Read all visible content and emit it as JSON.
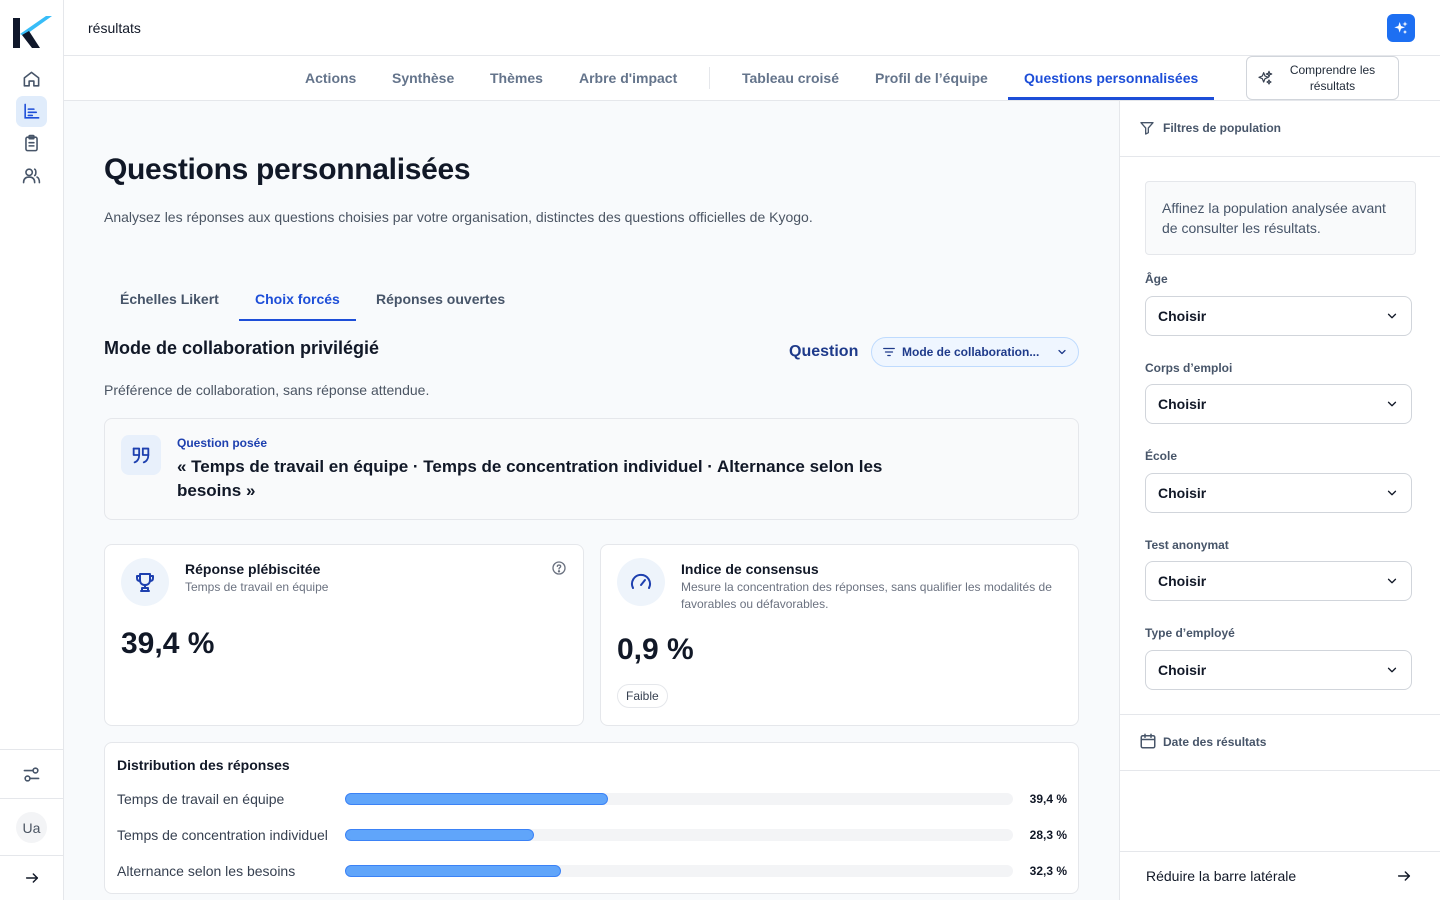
{
  "colors": {
    "accent": "#1d4ed8",
    "bar_fill": "#60a5fa",
    "ai_button": "#1d6ff2",
    "logo_dark": "#0f172a",
    "logo_light": "#38bdf8"
  },
  "rail": {
    "icons": [
      "home-icon",
      "chart-icon",
      "clipboard-icon",
      "users-icon"
    ],
    "bottom_icons": [
      "sliders-icon",
      "arrow-right-icon"
    ],
    "avatar_initials": "Ua"
  },
  "topbar": {
    "breadcrumb": "résultats",
    "ai_icon": "sparkles-icon"
  },
  "nav": {
    "tabs": [
      {
        "label": "Actions"
      },
      {
        "label": "Synthèse"
      },
      {
        "label": "Thèmes"
      },
      {
        "label": "Arbre d'impact"
      },
      {
        "label": "Tableau croisé"
      },
      {
        "label": "Profil de l’équipe"
      },
      {
        "label": "Questions personnalisées",
        "active": true
      }
    ],
    "understand_button": "Comprendre les résultats"
  },
  "main": {
    "title": "Questions personnalisées",
    "description": "Analysez les réponses aux questions choisies par votre organisation, distinctes des questions officielles de Kyogo.",
    "subtabs": [
      {
        "label": "Échelles Likert"
      },
      {
        "label": "Choix forcés",
        "active": true
      },
      {
        "label": "Réponses ouvertes"
      }
    ],
    "section_title": "Mode de collaboration privilégié",
    "question_label": "Question",
    "question_select": "Mode de collaboration...",
    "section_description": "Préférence de collaboration, sans réponse attendue.",
    "question_card": {
      "kicker": "Question posée",
      "text": "« Temps de travail en équipe · Temps de concentration individuel · Alternance selon les besoins »"
    },
    "kpi_top": {
      "title": "Réponse plébiscitée",
      "subtitle": "Temps de travail en équipe",
      "value": "39,4 %"
    },
    "kpi_consensus": {
      "title": "Indice de consensus",
      "subtitle": "Mesure la concentration des réponses, sans qualifier les modalités de favorables ou défavorables.",
      "value": "0,9 %",
      "badge": "Faible"
    },
    "distribution": {
      "title": "Distribution des réponses",
      "rows": [
        {
          "label": "Temps de travail en équipe",
          "value": 39.4,
          "display": "39,4 %"
        },
        {
          "label": "Temps de concentration individuel",
          "value": 28.3,
          "display": "28,3 %"
        },
        {
          "label": "Alternance selon les besoins",
          "value": 32.3,
          "display": "32,3 %"
        }
      ]
    }
  },
  "sidebar": {
    "filters_title": "Filtres de population",
    "info": "Affinez la population analysée avant de consulter les résultats.",
    "fields": [
      {
        "label": "Âge",
        "value": "Choisir"
      },
      {
        "label": "Corps d’emploi",
        "value": "Choisir"
      },
      {
        "label": "École",
        "value": "Choisir"
      },
      {
        "label": "Test anonymat",
        "value": "Choisir"
      },
      {
        "label": "Type d’employé",
        "value": "Choisir"
      }
    ],
    "date_title": "Date des résultats",
    "collapse_label": "Réduire la barre latérale"
  }
}
